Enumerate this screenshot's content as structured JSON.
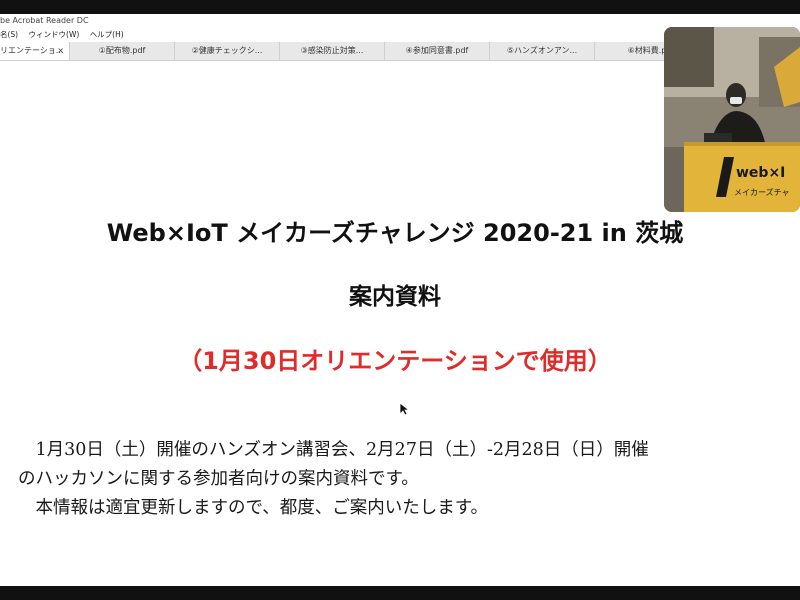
{
  "app": {
    "window_title": "be Acrobat Reader DC"
  },
  "menu": {
    "items": [
      "名(S)",
      "ウィンドウ(W)",
      "ヘルプ(H)"
    ]
  },
  "tabs": [
    {
      "label": "リエンテーショ...",
      "active": true
    },
    {
      "label": "①配布物.pdf",
      "active": false
    },
    {
      "label": "②健康チェックシ...",
      "active": false
    },
    {
      "label": "③感染防止対策...",
      "active": false
    },
    {
      "label": "④参加同意書.pdf",
      "active": false
    },
    {
      "label": "⑤ハンズオンアン...",
      "active": false
    },
    {
      "label": "⑥材料費.p",
      "active": false
    }
  ],
  "close_glyph": "×",
  "document": {
    "title": "Web×IoT メイカーズチャレンジ 2020-21 in 茨城",
    "subtitle": "案内資料",
    "highlight": "（1月30日オリエンテーションで使用）",
    "paragraph1_line1": "1月30日（土）開催のハンズオン講習会、2月27日（土）-2月28日（日）開催",
    "paragraph1_line2": "のハッカソンに関する参加者向けの案内資料です。",
    "paragraph2": "本情報は適宜更新しますので、都度、ご案内いたします。"
  },
  "video_overlay": {
    "banner_text_1": "web×I",
    "banner_text_2": "メイカーズチャ"
  },
  "colors": {
    "highlight": "#e02b2b",
    "banner": "#e3b43a"
  }
}
